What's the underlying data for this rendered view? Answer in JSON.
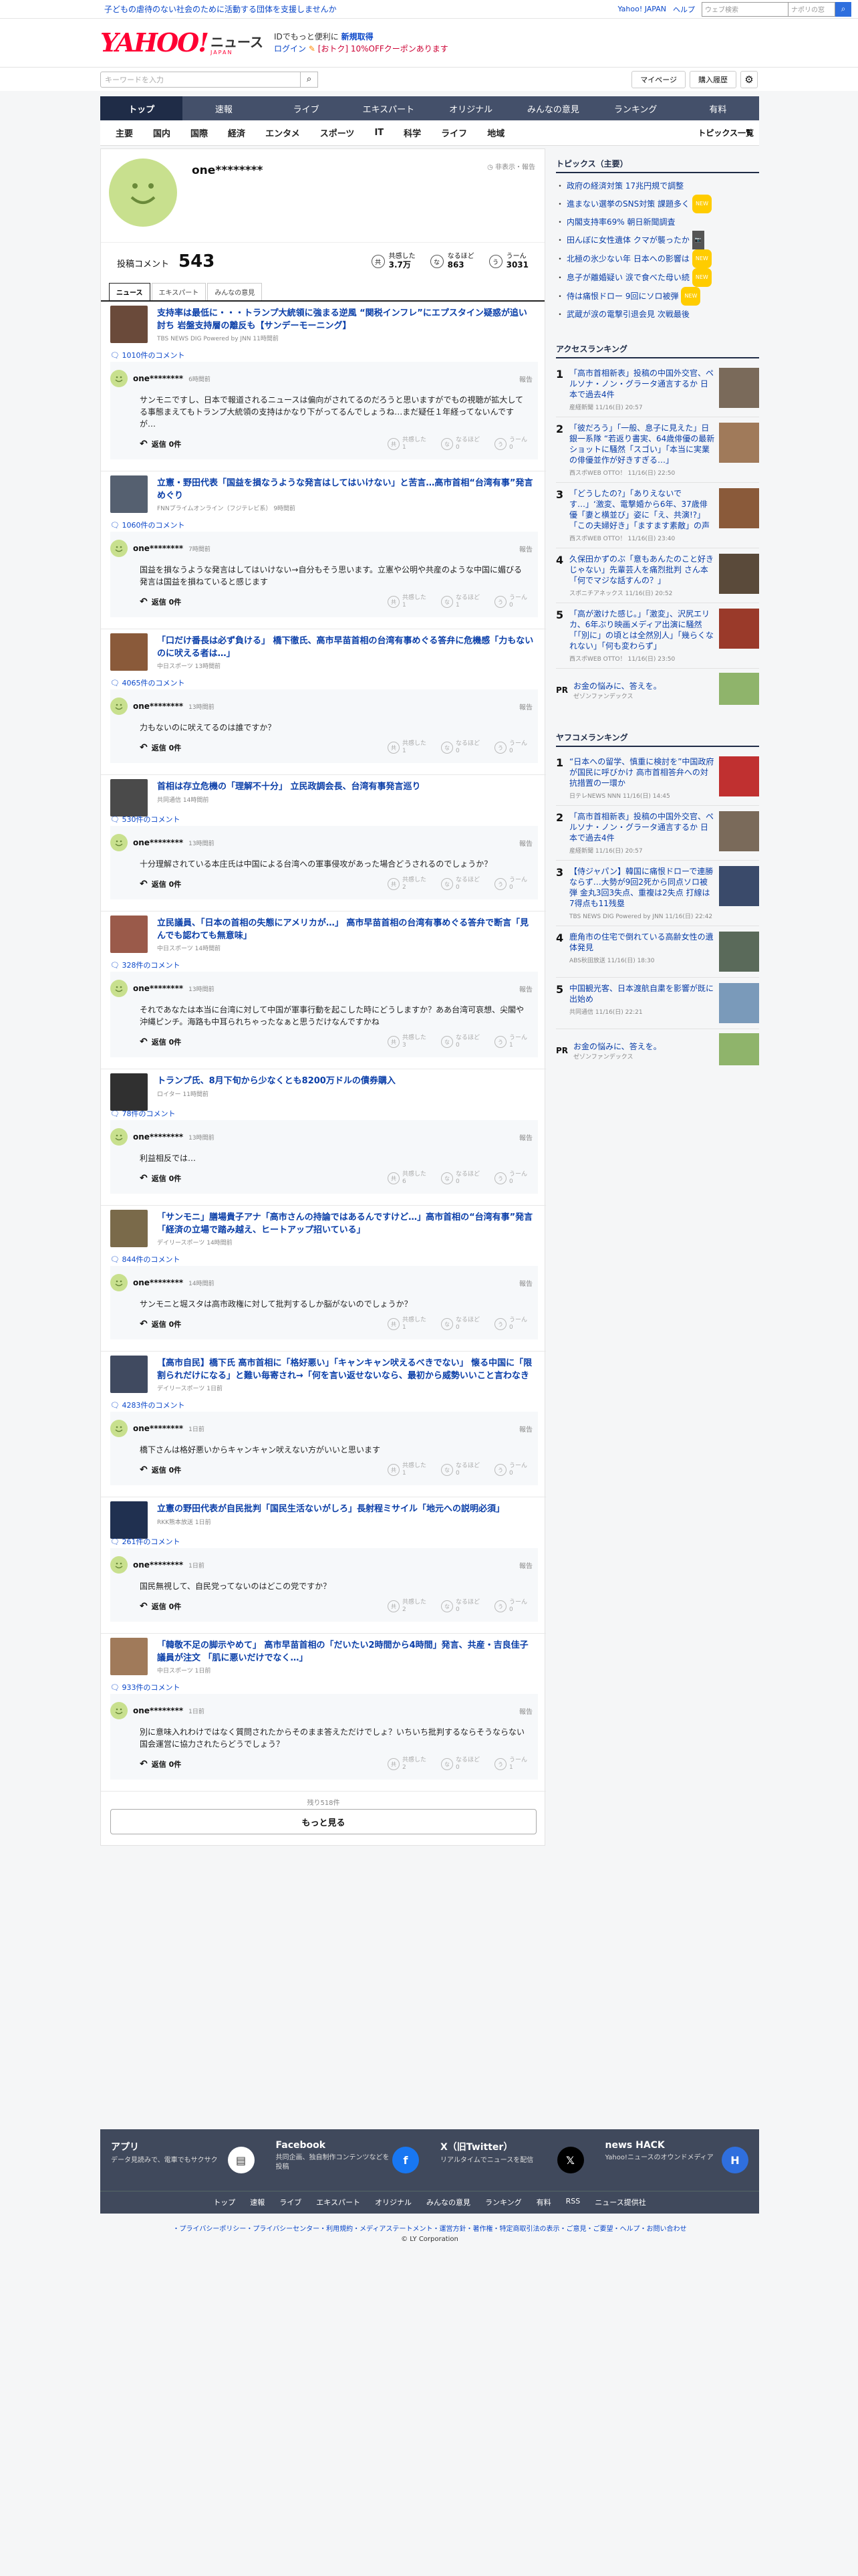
{
  "header": {
    "promo": "子どもの虐待のない社会のために活動する団体を支援しませんか",
    "links": [
      "Yahoo! JAPAN",
      "ヘルプ"
    ],
    "mini_search_placeholder": "ウェブ検索",
    "mini_search_suffix": "ナポリの窓",
    "logo": "YAHOO!",
    "logo_sub": "ニュース",
    "logo_jp": "JAPAN",
    "login_promo_1": "IDでもっと便利に",
    "login_promo_bold": "新規取得",
    "login_link": "ログイン",
    "coupon": "[おトク] 10%OFFクーポンあります",
    "keyword_placeholder": "キーワードを入力",
    "mypage": "マイページ",
    "history": "購入履歴"
  },
  "main_nav": [
    "トップ",
    "速報",
    "ライブ",
    "エキスパート",
    "オリジナル",
    "みんなの意見",
    "ランキング",
    "有料"
  ],
  "sub_nav": [
    "主要",
    "国内",
    "国際",
    "経済",
    "エンタメ",
    "スポーツ",
    "IT",
    "科学",
    "ライフ",
    "地域"
  ],
  "sub_nav_list": "トピックス一覧",
  "profile": {
    "name": "one********",
    "hide": "非表示・報告",
    "comment_label": "投稿コメント",
    "comment_count": "543",
    "reactions": [
      {
        "icon": "共",
        "label": "共感した",
        "value": "3.7万"
      },
      {
        "icon": "な",
        "label": "なるほど",
        "value": "863"
      },
      {
        "icon": "う",
        "label": "うーん",
        "value": "3031"
      }
    ],
    "tabs": [
      "ニュース",
      "エキスパート",
      "みんなの意見"
    ]
  },
  "entries": [
    {
      "thumb": "#6a4a3a",
      "title": "支持率は最低に・・・トランプ大統領に強まる逆風 “関税インフレ”にエプスタイン疑惑が追い討ち 岩盤支持層の離反も【サンデーモーニング】",
      "src": "TBS NEWS DIG Powered by JNN 11時間前",
      "count": "1010件のコメント",
      "user": "one********",
      "time": "6時間前",
      "text": "サンモニですし、日本で報道されるニュースは偏向がされてるのだろうと思いますがでもの視聴が拡大してる事態まえてもトランプ大統領の支持はかなり下がってるんでしょうね…まだ疑任１年経ってないんですが…",
      "reply": "返信 0件",
      "votes": [
        "1",
        "0",
        "0"
      ]
    },
    {
      "thumb": "#556070",
      "title": "立憲・野田代表「国益を損なうような発言はしてはいけない」と苦言…高市首相“台湾有事”発言めぐり",
      "src": "FNNプライムオンライン（フジテレビ系） 9時間前",
      "count": "1060件のコメント",
      "user": "one********",
      "time": "7時間前",
      "text": "国益を損なうような発言はしてはいけない→自分もそう思います。立憲や公明や共産のような中国に媚びる発言は国益を損ねていると感じます",
      "reply": "返信 0件",
      "votes": [
        "1",
        "1",
        "0"
      ]
    },
    {
      "thumb": "#8a5a3a",
      "title": "「口だけ番長は必ず負ける」 橋下徹氏、高市早苗首相の台湾有事めぐる答弁に危機感「力もないのに吠える者は…」",
      "src": "中日スポーツ 13時間前",
      "count": "4065件のコメント",
      "user": "one********",
      "time": "13時間前",
      "text": "力もないのに吠えてるのは誰ですか？",
      "reply": "返信 0件",
      "votes": [
        "1",
        "0",
        "0"
      ]
    },
    {
      "thumb": "#4a4a4a",
      "title": "首相は存立危機の「理解不十分」 立民政調会長、台湾有事発言巡り",
      "src": "共同通信 14時間前",
      "count": "530件のコメント",
      "user": "one********",
      "time": "13時間前",
      "text": "十分理解されている本庄氏は中国による台湾への軍事侵攻があった場合どうされるのでしょうか？",
      "reply": "返信 0件",
      "votes": [
        "2",
        "0",
        "0"
      ]
    },
    {
      "thumb": "#9a5a4a",
      "title": "立民議員、「日本の首相の失態にアメリカが…」 高市早苗首相の台湾有事めぐる答弁で断言「見んでも認わても無意味」",
      "src": "中日スポーツ 14時間前",
      "count": "328件のコメント",
      "user": "one********",
      "time": "13時間前",
      "text": "それであなたは本当に台湾に対して中国が軍事行動を起こした時にどうしますか？ああ台湾可哀想、尖閣や沖縄ピンチ。海路も中耳られちゃったなぁと思うだけなんですかね",
      "reply": "返信 0件",
      "votes": [
        "3",
        "0",
        "1"
      ]
    },
    {
      "thumb": "#303030",
      "title": "トランプ氏、8月下旬から少なくとも8200万ドルの債券購入",
      "src": "ロイター 11時間前",
      "count": "78件のコメント",
      "user": "one********",
      "time": "13時間前",
      "text": "利益相反では…",
      "reply": "返信 0件",
      "votes": [
        "6",
        "0",
        "0"
      ]
    },
    {
      "thumb": "#7a6a4a",
      "title": "「サンモニ」膳場貴子アナ「高市さんの持論ではあるんですけど…」高市首相の“台湾有事”発言「経済の立場で踏み越え、ヒートアップ招いている」",
      "src": "デイリースポーツ 14時間前",
      "count": "844件のコメント",
      "user": "one********",
      "time": "14時間前",
      "text": "サンモニと堀スタは高市政権に対して批判するしか脳がないのでしょうか？",
      "reply": "返信 0件",
      "votes": [
        "1",
        "0",
        "0"
      ]
    },
    {
      "thumb": "#404a60",
      "title": "【高市自民】橋下氏 高市首相に「格好悪い」「キャンキャン吠えるべきでない」 懐る中国に「限割られだけになる」と難い毎寄され→「何を言い返せないなら、最初から威勢いいこと言わなきゃいい」戦略性なしと",
      "src": "デイリースポーツ 1日前",
      "count": "4283件のコメント",
      "user": "one********",
      "time": "1日前",
      "text": "橋下さんは格好悪いからキャンキャン吠えない方がいいと思います",
      "reply": "返信 0件",
      "votes": [
        "1",
        "0",
        "0"
      ]
    },
    {
      "thumb": "#203050",
      "title": "立憲の野田代表が自民批判「国民生活ないがしろ」長射程ミサイル「地元への説明必須」",
      "src": "RKK熊本放送 1日前",
      "count": "261件のコメント",
      "user": "one********",
      "time": "1日前",
      "text": "国民無視して、自民党ってないのはどこの党ですか？",
      "reply": "返信 0件",
      "votes": [
        "2",
        "0",
        "0"
      ]
    },
    {
      "thumb": "#a07a5a",
      "title": "「韓敬不足の脚示やめて」 高市早苗首相の「だいたい2時間から4時間」発言、共産・吉良佳子議員が注文 「肌に悪いだけでなく…」",
      "src": "中日スポーツ 1日前",
      "count": "933件のコメント",
      "user": "one********",
      "time": "1日前",
      "text": "別に意味入れわけではなく質問されたからそのまま答えただけでしょ？いちいち批判するならそうならない国会運営に協力されたらどうでしょう？",
      "reply": "返信 0件",
      "votes": [
        "2",
        "0",
        "1"
      ]
    }
  ],
  "remaining": "残り518件",
  "more": "もっと見る",
  "side": {
    "topics_title": "トピックス（主要）",
    "topics": [
      {
        "text": "政府の経済対策 17兆円規で調整",
        "badge": ""
      },
      {
        "text": "進まない選挙のSNS対策 課題多く",
        "badge": "NEW"
      },
      {
        "text": "内閣支持率69% 朝日新聞調査",
        "badge": ""
      },
      {
        "text": "田んぼに女性遺体 クマが襲ったか",
        "badge": "📷"
      },
      {
        "text": "北極の氷少ない年 日本への影響は",
        "badge": "NEW"
      },
      {
        "text": "息子が離婚疑い 涙で食べた母い続",
        "badge": "NEW"
      },
      {
        "text": "侍は痛恨ドロー 9回にソロ被弾",
        "badge": "NEW"
      },
      {
        "text": "武蔵が涙の電撃引退会見 次戦最後",
        "badge": ""
      }
    ],
    "access_title": "アクセスランキング",
    "access": [
      {
        "num": "1",
        "text": "「高市首相新表」投稿の中国外交官、ペルソナ・ノン・グラータ通言するか 日本で過去4件",
        "src": "産経新聞 11/16(日) 20:57",
        "color": "#7a6a5a"
      },
      {
        "num": "2",
        "text": "「彼だろう」「一般、息子に見えた」日銀一系隊 “若返り書実、64歳俳優の最新ショットに騒然「スゴい」「本当に実業の俳優並作が好きすぎる…」",
        "src": "西スポWEB OTTO！ 11/16(日) 22:50",
        "color": "#a07a5a"
      },
      {
        "num": "3",
        "text": "「どうしたの?」「ありえないです…」‘激変、電撃婚から6年、37歳俳優「妻と横並び」姿に「え、共演!?」「この夫婦好き」「ますます素敵」の声",
        "src": "西スポWEB OTTO！ 11/16(日) 23:40",
        "color": "#8a5a3a"
      },
      {
        "num": "4",
        "text": "久保田かずのぶ「意もあんたのこと好きじゃない」先輩芸人を痛烈批判 さん本「何でマジな話すんの？」",
        "src": "スポニチアネックス 11/16(日) 20:52",
        "color": "#5a4a3a"
      },
      {
        "num": "5",
        "text": "「高が激けた感じ。」「激変」、沢尻エリカ、6年ぶり映画メディア出演に騒然「「別に」の頃とは全然別人」「幾らくなれない」「何も変わらず」",
        "src": "西スポWEB OTTO！ 11/16(日) 23:50",
        "color": "#9a3a2a"
      }
    ],
    "pr_label": "PR",
    "pr_text": "お金の悩みに、答えを。",
    "pr_src": "ゼゾンファンデックス",
    "yaco_title": "ヤフコメランキング",
    "yaco": [
      {
        "num": "1",
        "text": "“日本への留学、慎重に検討を”中国政府が国民に呼びかけ 高市首相答弁への対抗措置の一環か",
        "src": "日テレNEWS NNN 11/16(日) 14:45",
        "color": "#c03030"
      },
      {
        "num": "2",
        "text": "「高市首相新表」投稿の中国外交官、ペルソナ・ノン・グラータ通言するか 日本で過去4件",
        "src": "産経新聞 11/16(日) 20:57",
        "color": "#7a6a5a"
      },
      {
        "num": "3",
        "text": "【侍ジャパン】韓国に痛恨ドローで連勝ならず…大勢が9回2死から同点ソロ被弾 金丸3回3失点、重複は2失点 打線は7得点も11残塁",
        "src": "TBS NEWS DIG Powered by JNN 11/16(日) 22:42",
        "color": "#3a4a6a"
      },
      {
        "num": "4",
        "text": "鹿角市の住宅で倒れている高齢女性の遺体発見",
        "src": "ABS秋田放送 11/16(日) 18:30",
        "color": "#5a6a5a"
      },
      {
        "num": "5",
        "text": "中国観光客、日本渡航自粛を影響が既に出始め",
        "src": "共同通信 11/16(日) 22:21",
        "color": "#7a9aba"
      }
    ]
  },
  "footer": {
    "apps": [
      {
        "title": "アプリ",
        "desc": "データ見読みで、電車でもサクサク",
        "icon": "▤",
        "bg": "#fff",
        "fg": "#333"
      },
      {
        "title": "Facebook",
        "desc": "共同企画、独自制作コンテンツなどを投稿",
        "icon": "f",
        "bg": "#1877f2",
        "fg": "#fff"
      },
      {
        "title": "X（旧Twitter）",
        "desc": "リアルタイムでニュースを配信",
        "icon": "𝕏",
        "bg": "#000",
        "fg": "#fff"
      },
      {
        "title": "news HACK",
        "desc": "Yahoo!ニュースのオウンドメディア",
        "icon": "H",
        "bg": "#2f6fde",
        "fg": "#fff"
      }
    ],
    "nav": [
      "トップ",
      "速報",
      "ライブ",
      "エキスパート",
      "オリジナル",
      "みんなの意見",
      "ランキング",
      "有料",
      "RSS",
      "ニュース提供社"
    ],
    "links": "・プライバシーポリシー・プライバシーセンター・利用規約・メディアステートメント・運営方針・著作権・特定商取引法の表示・ご意見・ご要望・ヘルプ・お問い合わせ",
    "copy": "© LY Corporation"
  }
}
